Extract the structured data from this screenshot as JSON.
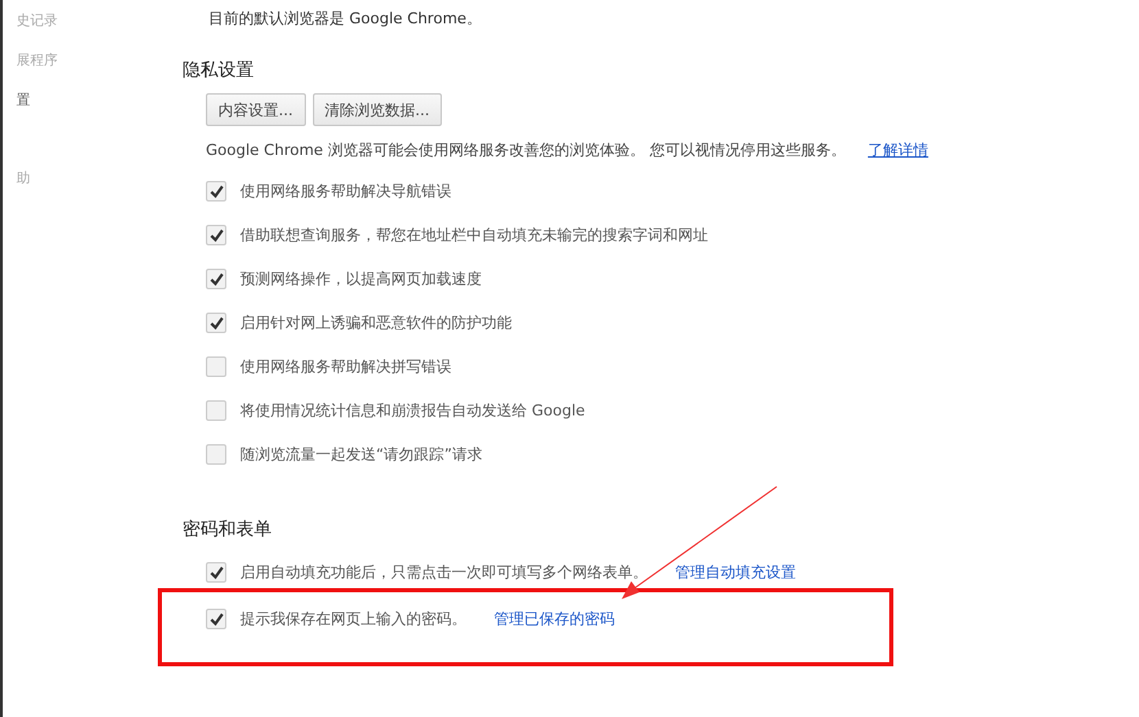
{
  "sidebar": {
    "items": [
      {
        "label": "史记录",
        "selected": false
      },
      {
        "label": "展程序",
        "selected": false
      },
      {
        "label": "置",
        "selected": true
      },
      {
        "label": "助",
        "selected": false
      }
    ]
  },
  "default_browser_text": "目前的默认浏览器是 Google Chrome。",
  "privacy": {
    "heading": "隐私设置",
    "buttons": [
      "内容设置...",
      "清除浏览数据..."
    ],
    "description": "Google Chrome 浏览器可能会使用网络服务改善您的浏览体验。 您可以视情况停用这些服务。",
    "learn_more": "了解详情",
    "options": [
      {
        "label": "使用网络服务帮助解决导航错误",
        "checked": true
      },
      {
        "label": "借助联想查询服务，帮您在地址栏中自动填充未输完的搜索字词和网址",
        "checked": true
      },
      {
        "label": "预测网络操作，以提高网页加载速度",
        "checked": true
      },
      {
        "label": "启用针对网上诱骗和恶意软件的防护功能",
        "checked": true
      },
      {
        "label": "使用网络服务帮助解决拼写错误",
        "checked": false
      },
      {
        "label": "将使用情况统计信息和崩溃报告自动发送给 Google",
        "checked": false
      },
      {
        "label": "随浏览流量一起发送“请勿跟踪”请求",
        "checked": false
      }
    ]
  },
  "passwords": {
    "heading": "密码和表单",
    "options": [
      {
        "label": "启用自动填充功能后，只需点击一次即可填写多个网络表单。",
        "link": "管理自动填充设置",
        "checked": true,
        "highlighted": false
      },
      {
        "label": "提示我保存在网页上输入的密码。",
        "link": "管理已保存的密码",
        "checked": true,
        "highlighted": true
      }
    ]
  }
}
